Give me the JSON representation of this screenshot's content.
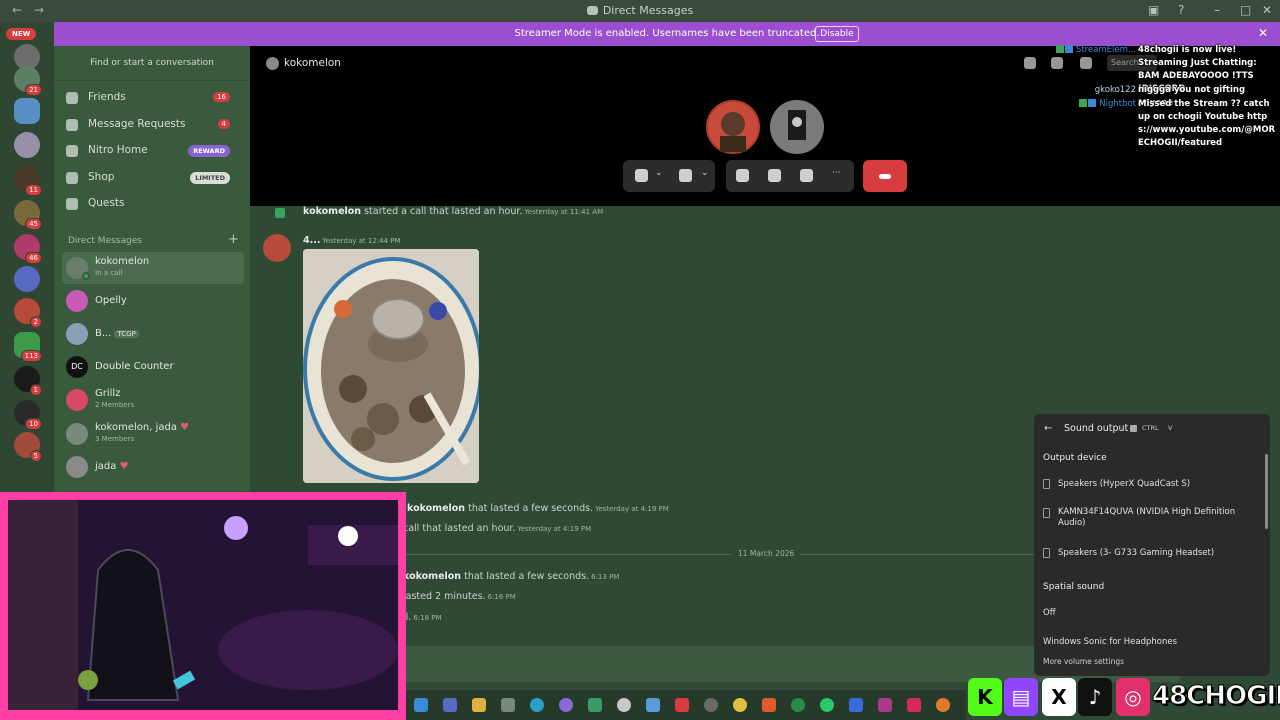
{
  "window": {
    "title": "Direct Messages"
  },
  "rail": {
    "new_label": "NEW",
    "badges": [
      "21",
      "11",
      "45",
      "46",
      "2",
      "113",
      "1",
      "10",
      "5"
    ]
  },
  "banner": {
    "text": "Streamer Mode is enabled. Usernames have been truncated.",
    "disable_label": "Disable"
  },
  "sidebar": {
    "search_placeholder": "Find or start a conversation",
    "nav": [
      {
        "label": "Friends",
        "badge": "16"
      },
      {
        "label": "Message Requests",
        "badge": "4"
      },
      {
        "label": "Nitro Home",
        "pill": "REWARD"
      },
      {
        "label": "Shop",
        "pill": "LIMITED"
      },
      {
        "label": "Quests"
      }
    ],
    "dm_header": "Direct Messages",
    "dms": [
      {
        "name": "kokomelon",
        "sub": "In a call"
      },
      {
        "name": "Opelly"
      },
      {
        "name": "B...",
        "tag": "TCGP"
      },
      {
        "name": "Double Counter",
        "avatar_text": "DC"
      },
      {
        "name": "Grillz",
        "sub": "2 Members"
      },
      {
        "name": "kokomelon, jada",
        "sub": "3 Members"
      },
      {
        "name": "jada"
      }
    ]
  },
  "call": {
    "channel": "kokomelon",
    "search_placeholder": "Search"
  },
  "chat": {
    "messages": [
      {
        "user": "kokomelon",
        "text": "started a call that lasted an hour.",
        "time": "Yesterday at 11:41 AM"
      },
      {
        "user": "4...",
        "time": "Yesterday at 12:44 PM"
      },
      {
        "user": "kokomelon",
        "text": "that lasted a few seconds.",
        "time": "Yesterday at 4:19 PM"
      },
      {
        "text": "call that lasted an hour.",
        "time": "Yesterday at 4:19 PM"
      },
      {
        "user": "kokomelon",
        "text": "that lasted a few seconds.",
        "time": "6:13 PM"
      },
      {
        "text": "lasted 2 minutes.",
        "time": "6:16 PM"
      },
      {
        "text": "ll.",
        "time": "6:18 PM"
      }
    ],
    "date_divider": "11 March 2026"
  },
  "stream_chat": [
    {
      "user": "StreamElem...",
      "user_color": "#3b8ad8",
      "msg": "48chogii is now live! Streaming Just Chatting: BAM ADEBAYOOOO !TTS !DISCORD"
    },
    {
      "user": "gkoko122",
      "user_color": "#bcd3f0",
      "msg": "niggga you not gifting anyone"
    },
    {
      "user": "Nightbot",
      "user_color": "#3b8ad8",
      "msg": "Missed the Stream ?? catch up on cchogii Youtube https://www.youtube.com/@MORECHOGII/featured"
    }
  ],
  "sound_panel": {
    "title": "Sound output",
    "shortcut": [
      "CTRL",
      "V"
    ],
    "output_header": "Output device",
    "devices": [
      "Speakers (HyperX QuadCast S)",
      "KAMN34F14QUVA (NVIDIA High Definition Audio)",
      "Speakers (3- G733 Gaming Headset)"
    ],
    "spatial_header": "Spatial sound",
    "spatial_options": [
      "Off",
      "Windows Sonic for Headphones"
    ],
    "more_label": "More volume settings"
  },
  "overlay": {
    "handle": "48CHOGII"
  }
}
